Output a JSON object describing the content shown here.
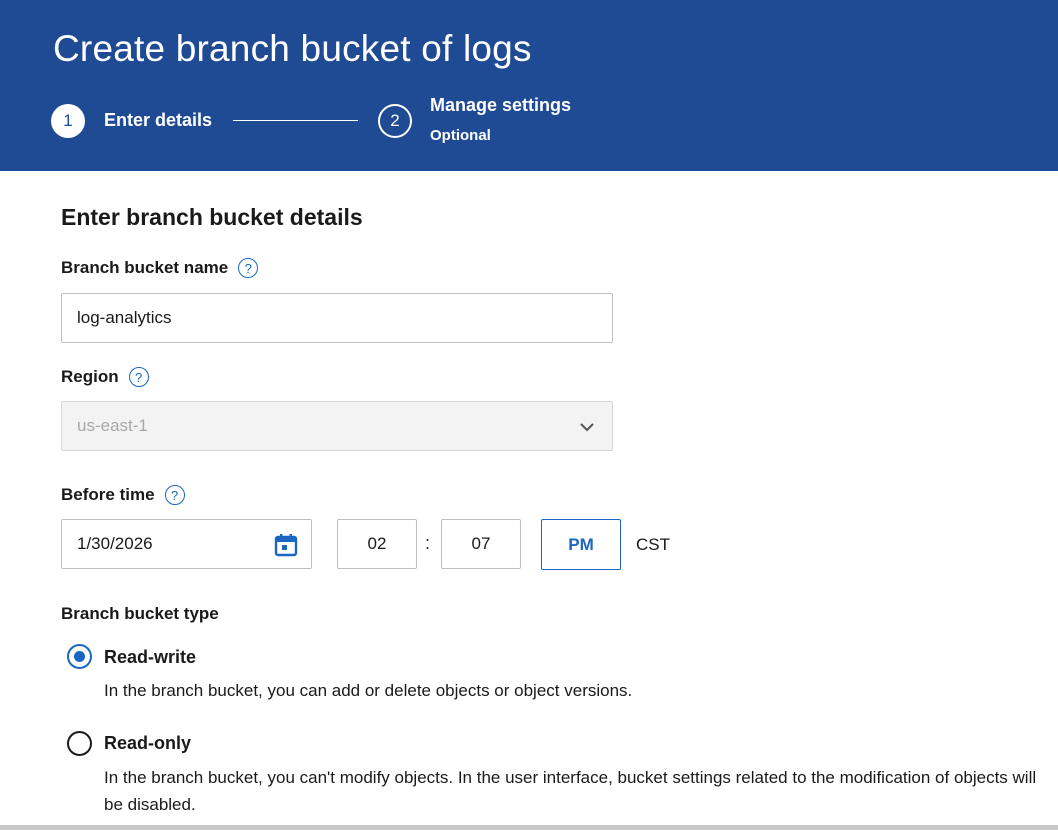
{
  "header": {
    "title": "Create branch bucket of logs",
    "steps": [
      {
        "number": "1",
        "label": "Enter details",
        "sublabel": ""
      },
      {
        "number": "2",
        "label": "Manage settings",
        "sublabel": "Optional"
      }
    ]
  },
  "form": {
    "section_title": "Enter branch bucket details",
    "name": {
      "label": "Branch bucket name",
      "value": "log-analytics"
    },
    "region": {
      "label": "Region",
      "value": "us-east-1"
    },
    "before_time": {
      "label": "Before time",
      "date": "1/30/2026",
      "hour": "02",
      "minute": "07",
      "separator": ":",
      "ampm": "PM",
      "timezone": "CST"
    },
    "bucket_type": {
      "label": "Branch bucket type",
      "options": [
        {
          "label": "Read-write",
          "description": "In the branch bucket, you can add or delete objects or object versions.",
          "selected": true
        },
        {
          "label": "Read-only",
          "description": "In the branch bucket, you can't modify objects. In the user interface, bucket settings related to the modification of objects will be disabled.",
          "selected": false
        }
      ]
    }
  },
  "icons": {
    "help": "help-circle-icon",
    "chevron": "chevron-down-icon",
    "calendar": "calendar-icon"
  },
  "colors": {
    "header_bg": "#1f4a94",
    "accent": "#1a66c2"
  }
}
